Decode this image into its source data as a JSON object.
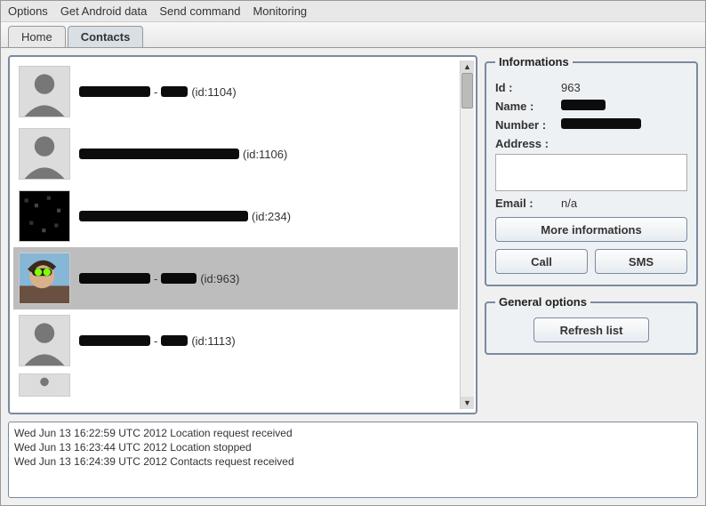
{
  "menu": {
    "items": [
      "Options",
      "Get Android data",
      "Send command",
      "Monitoring"
    ]
  },
  "tabs": {
    "items": [
      "Home",
      "Contacts"
    ],
    "active_index": 1
  },
  "contacts": [
    {
      "id_label": "(id:1104)",
      "avatar": "silhouette",
      "selected": false
    },
    {
      "id_label": "(id:1106)",
      "avatar": "silhouette",
      "selected": false
    },
    {
      "id_label": "(id:234)",
      "avatar": "noise",
      "selected": false
    },
    {
      "id_label": "(id:963)",
      "avatar": "photo",
      "selected": true
    },
    {
      "id_label": "(id:1113)",
      "avatar": "silhouette",
      "selected": false
    },
    {
      "id_label": "",
      "avatar": "silhouette",
      "selected": false
    }
  ],
  "info": {
    "legend": "Informations",
    "id_label": "Id :",
    "id_value": "963",
    "name_label": "Name :",
    "name_value": "",
    "number_label": "Number :",
    "number_value": "",
    "address_label": "Address :",
    "email_label": "Email :",
    "email_value": "n/a",
    "more_btn": "More informations",
    "call_btn": "Call",
    "sms_btn": "SMS"
  },
  "general": {
    "legend": "General options",
    "refresh_btn": "Refresh list"
  },
  "log": {
    "lines": [
      "Wed Jun 13 16:22:59 UTC 2012 Location request received",
      "Wed Jun 13 16:23:44 UTC 2012 Location stopped",
      "Wed Jun 13 16:24:39 UTC 2012 Contacts request received"
    ]
  }
}
